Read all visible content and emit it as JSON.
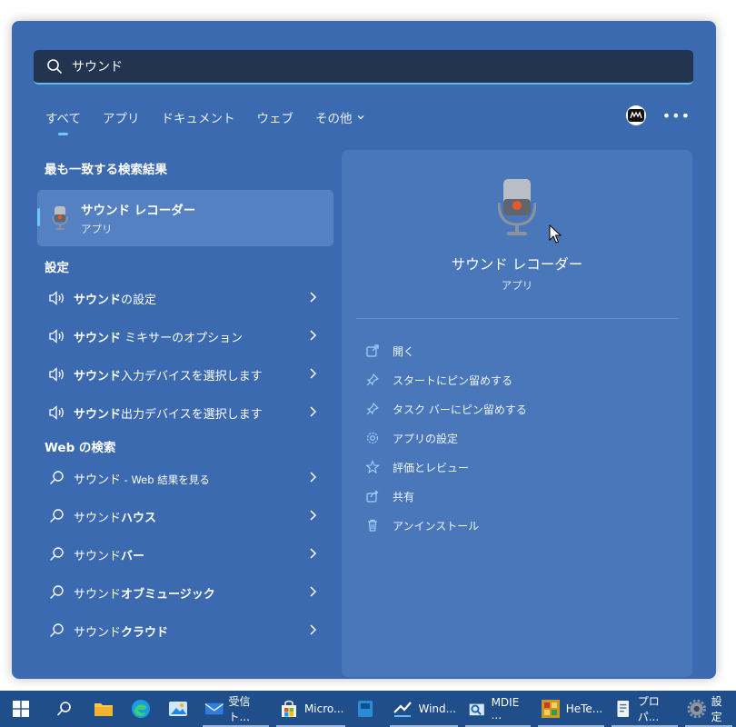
{
  "search": {
    "query": "サウンド"
  },
  "tabs": [
    {
      "label": "すべて"
    },
    {
      "label": "アプリ"
    },
    {
      "label": "ドキュメント"
    },
    {
      "label": "ウェブ"
    },
    {
      "label": "その他"
    }
  ],
  "best_match": {
    "section_title": "最も一致する検索結果",
    "name": "サウンド レコーダー",
    "type": "アプリ"
  },
  "settings": {
    "section_title": "設定",
    "items": [
      {
        "bold": "サウンド",
        "rest": "の設定"
      },
      {
        "bold": "サウンド",
        "rest": " ミキサーのオプション"
      },
      {
        "bold": "サウンド",
        "rest": "入力デバイスを選択します"
      },
      {
        "bold": "サウンド",
        "rest": "出力デバイスを選択します"
      }
    ]
  },
  "web": {
    "section_title": "Web の検索",
    "items": [
      {
        "plain": "サウンド",
        "small": " - Web 結果を見る",
        "bold": ""
      },
      {
        "plain": "サウンド",
        "small": "",
        "bold": "ハウス"
      },
      {
        "plain": "サウンド",
        "small": "",
        "bold": "バー"
      },
      {
        "plain": "サウンド",
        "small": "",
        "bold": "オブミュージック"
      },
      {
        "plain": "サウンド",
        "small": "",
        "bold": "クラウド"
      }
    ]
  },
  "detail": {
    "title": "サウンド レコーダー",
    "subtitle": "アプリ",
    "actions": [
      {
        "label": "開く",
        "icon": "open-external-icon"
      },
      {
        "label": "スタートにピン留めする",
        "icon": "pin-icon"
      },
      {
        "label": "タスク バーにピン留めする",
        "icon": "pin-icon"
      },
      {
        "label": "アプリの設定",
        "icon": "gear-icon"
      },
      {
        "label": "評価とレビュー",
        "icon": "star-icon"
      },
      {
        "label": "共有",
        "icon": "share-icon"
      },
      {
        "label": "アンインストール",
        "icon": "trash-icon"
      }
    ]
  },
  "taskbar": {
    "items": [
      {
        "label": "受信ト...",
        "icon": "mail-icon"
      },
      {
        "label": "Micro...",
        "icon": "store-icon"
      },
      {
        "label": "Wind...",
        "icon": "app-icon"
      },
      {
        "label": "MDIE ...",
        "icon": "app-icon"
      },
      {
        "label": "HeTe...",
        "icon": "app-icon"
      },
      {
        "label": "プロパ...",
        "icon": "properties-icon"
      },
      {
        "label": "設定",
        "icon": "gear-icon"
      }
    ]
  },
  "colors": {
    "panel": "#3b6ab0",
    "accent": "#70c6ff",
    "taskbar": "#1f4e8a",
    "search_bg": "#233451"
  }
}
